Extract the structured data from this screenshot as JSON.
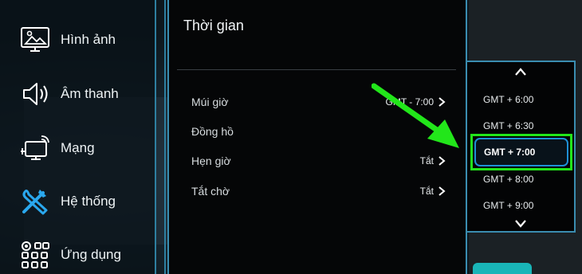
{
  "sidebar": {
    "items": [
      {
        "label": "Hình ảnh",
        "icon": "picture-icon"
      },
      {
        "label": "Âm thanh",
        "icon": "speaker-icon"
      },
      {
        "label": "Mạng",
        "icon": "network-icon"
      },
      {
        "label": "Hệ thống",
        "icon": "tools-icon"
      },
      {
        "label": "Ứng dụng",
        "icon": "apps-icon"
      }
    ]
  },
  "panel": {
    "title": "Thời gian",
    "rows": [
      {
        "label": "Múi giờ",
        "value": "GMT - 7:00"
      },
      {
        "label": "Đồng hồ",
        "value": ""
      },
      {
        "label": "Hẹn giờ",
        "value": "Tắt"
      },
      {
        "label": "Tắt chờ",
        "value": "Tắt"
      }
    ]
  },
  "dropdown": {
    "options": [
      "GMT + 6:00",
      "GMT + 6:30",
      "GMT + 7:00",
      "GMT + 8:00",
      "GMT + 9:00"
    ],
    "selected": "GMT + 7:00"
  },
  "colors": {
    "highlight": "#22e61a",
    "focus": "#1e90d6",
    "frame": "#3a8db0"
  }
}
